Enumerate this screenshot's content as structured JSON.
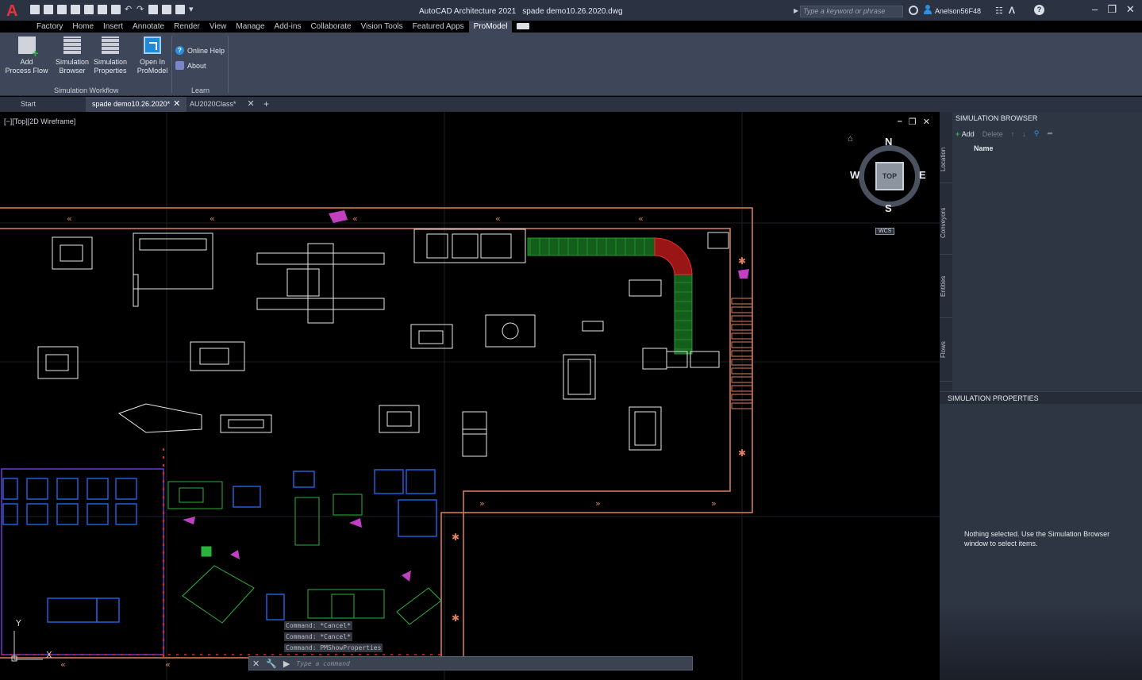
{
  "titlebar": {
    "app_name": "AutoCAD Architecture 2021",
    "file_name": "spade demo10.26.2020.dwg",
    "search_placeholder": "Type a keyword or phrase",
    "user_name": "Anelson56F48"
  },
  "ribbon_tabs": [
    "Factory",
    "Home",
    "Insert",
    "Annotate",
    "Render",
    "View",
    "Manage",
    "Add-ins",
    "Collaborate",
    "Vision Tools",
    "Featured Apps",
    "ProModel"
  ],
  "ribbon_active_tab": "ProModel",
  "ribbon": {
    "add_process_flow": [
      "Add",
      "Process Flow"
    ],
    "simulation_browser": [
      "Simulation",
      "Browser"
    ],
    "simulation_properties": [
      "Simulation",
      "Properties"
    ],
    "open_in_promodel": [
      "Open In",
      "ProModel"
    ],
    "online_help": "Online Help",
    "about": "About",
    "group_workflow": "Simulation Workflow",
    "group_learn": "Learn"
  },
  "file_tabs": {
    "start": "Start",
    "active": "spade demo10.26.2020*",
    "other": "AU2020Class*",
    "new": "+"
  },
  "viewport": {
    "label": "[−][Top][2D Wireframe]",
    "viewcube": {
      "north": "N",
      "south": "S",
      "east": "E",
      "west": "W",
      "face": "TOP",
      "wcs": "WCS"
    }
  },
  "command_history": [
    "Command: *Cancel*",
    "Command: *Cancel*",
    "Command: PMShowProperties"
  ],
  "command_placeholder": "Type a command",
  "palette": {
    "browser_title": "SIMULATION BROWSER",
    "add": "Add",
    "delete": "Delete",
    "name_column": "Name",
    "vertical_tabs": [
      "Location",
      "Conveyors",
      "Entities",
      "Flows"
    ],
    "properties_title": "SIMULATION PROPERTIES",
    "empty_message": "Nothing selected.  Use the Simulation Browser window to select items."
  },
  "colors": {
    "titlebar_bg": "#2b3342",
    "ribbon_bg": "#3d4759",
    "palette_bg": "#2e3543",
    "conveyor_green": "#1f8a2a",
    "conveyor_red": "#d02020",
    "wall_orange": "#e08060",
    "equipment_blue": "#1e5fd8",
    "equipment_white": "#e8e8e8",
    "magenta": "#c040c0"
  }
}
